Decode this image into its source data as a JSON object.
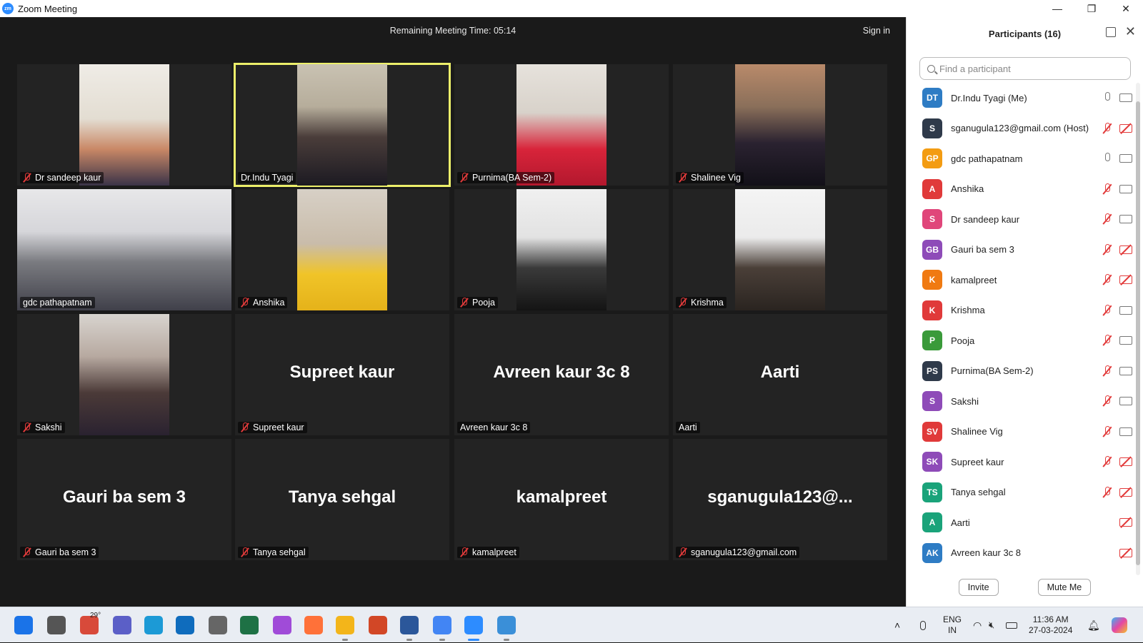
{
  "window": {
    "title": "Zoom Meeting",
    "controls": [
      "—",
      "❐",
      "✕"
    ]
  },
  "meeting": {
    "timer": "Remaining Meeting Time: 05:14",
    "sign_in": "Sign in"
  },
  "tiles": [
    {
      "name": "Dr sandeep kaur",
      "muted": true,
      "video": "office"
    },
    {
      "name": "Dr.Indu Tyagi",
      "muted": false,
      "video": "frames",
      "active": true
    },
    {
      "name": "Purnima(BA Sem-2)",
      "muted": true,
      "video": "red"
    },
    {
      "name": "Shalinee Vig",
      "muted": true,
      "video": "floral"
    },
    {
      "name": "gdc pathapatnam",
      "muted": false,
      "video": "class"
    },
    {
      "name": "Anshika",
      "muted": true,
      "video": "yellow"
    },
    {
      "name": "Pooja",
      "muted": true,
      "video": "black"
    },
    {
      "name": "Krishma",
      "muted": true,
      "video": "white"
    },
    {
      "name": "Sakshi",
      "muted": true,
      "video": "girl"
    },
    {
      "name": "Supreet kaur",
      "muted": true,
      "big": "Supreet kaur"
    },
    {
      "name": "Avreen kaur 3c 8",
      "muted": false,
      "big": "Avreen kaur 3c 8"
    },
    {
      "name": "Aarti",
      "muted": false,
      "big": "Aarti"
    },
    {
      "name": "Gauri ba sem 3",
      "muted": true,
      "big": "Gauri ba sem 3"
    },
    {
      "name": "Tanya sehgal",
      "muted": true,
      "big": "Tanya sehgal"
    },
    {
      "name": "kamalpreet",
      "muted": true,
      "big": "kamalpreet"
    },
    {
      "name": "sganugula123@gmail.com",
      "muted": true,
      "big": "sganugula123@..."
    }
  ],
  "participants_panel": {
    "title": "Participants (16)",
    "search_placeholder": "Find a participant",
    "invite_label": "Invite",
    "mute_me_label": "Mute Me",
    "list": [
      {
        "initials": "DT",
        "name": "Dr.Indu Tyagi (Me)",
        "color": "#2e7cc4",
        "mic": "on",
        "cam": "on"
      },
      {
        "initials": "S",
        "name": "sganugula123@gmail.com (Host)",
        "color": "#2f3a4a",
        "mic": "off",
        "cam": "off"
      },
      {
        "initials": "GP",
        "name": "gdc pathapatnam",
        "color": "#f39c12",
        "mic": "on",
        "cam": "on"
      },
      {
        "initials": "A",
        "name": "Anshika",
        "color": "#e03a3a",
        "mic": "off",
        "cam": "on"
      },
      {
        "initials": "S",
        "name": "Dr sandeep kaur",
        "color": "#e0467a",
        "mic": "off",
        "cam": "on"
      },
      {
        "initials": "GB",
        "name": "Gauri ba sem 3",
        "color": "#8e4bb8",
        "mic": "off",
        "cam": "off"
      },
      {
        "initials": "K",
        "name": "kamalpreet",
        "color": "#f07a12",
        "mic": "off",
        "cam": "off"
      },
      {
        "initials": "K",
        "name": "Krishma",
        "color": "#e03a3a",
        "mic": "off",
        "cam": "on"
      },
      {
        "initials": "P",
        "name": "Pooja",
        "color": "#3a9a3a",
        "mic": "off",
        "cam": "on"
      },
      {
        "initials": "PS",
        "name": "Purnima(BA Sem-2)",
        "color": "#2f3a4a",
        "mic": "off",
        "cam": "on"
      },
      {
        "initials": "S",
        "name": "Sakshi",
        "color": "#8e4bb8",
        "mic": "off",
        "cam": "on"
      },
      {
        "initials": "SV",
        "name": "Shalinee Vig",
        "color": "#e03a3a",
        "mic": "off",
        "cam": "on"
      },
      {
        "initials": "SK",
        "name": "Supreet kaur",
        "color": "#8e4bb8",
        "mic": "off",
        "cam": "off"
      },
      {
        "initials": "TS",
        "name": "Tanya sehgal",
        "color": "#1aa37a",
        "mic": "off",
        "cam": "off"
      },
      {
        "initials": "A",
        "name": "Aarti",
        "color": "#1aa37a",
        "mic": "none",
        "cam": "off"
      },
      {
        "initials": "AK",
        "name": "Avreen kaur 3c 8",
        "color": "#2e7cc4",
        "mic": "none",
        "cam": "off"
      }
    ]
  },
  "taskbar": {
    "weather": "29°",
    "lang_line1": "ENG",
    "lang_line2": "IN",
    "time": "11:36 AM",
    "date": "27-03-2024",
    "apps": [
      "start-icon",
      "task-view-icon",
      "weather-icon",
      "teams-icon",
      "edge-icon",
      "mail-icon",
      "camera-icon",
      "excel-icon",
      "messenger-icon",
      "firefox-icon",
      "file-explorer-icon",
      "powerpoint-icon",
      "word-icon",
      "chrome-icon",
      "zoom-icon",
      "photos-icon"
    ]
  }
}
